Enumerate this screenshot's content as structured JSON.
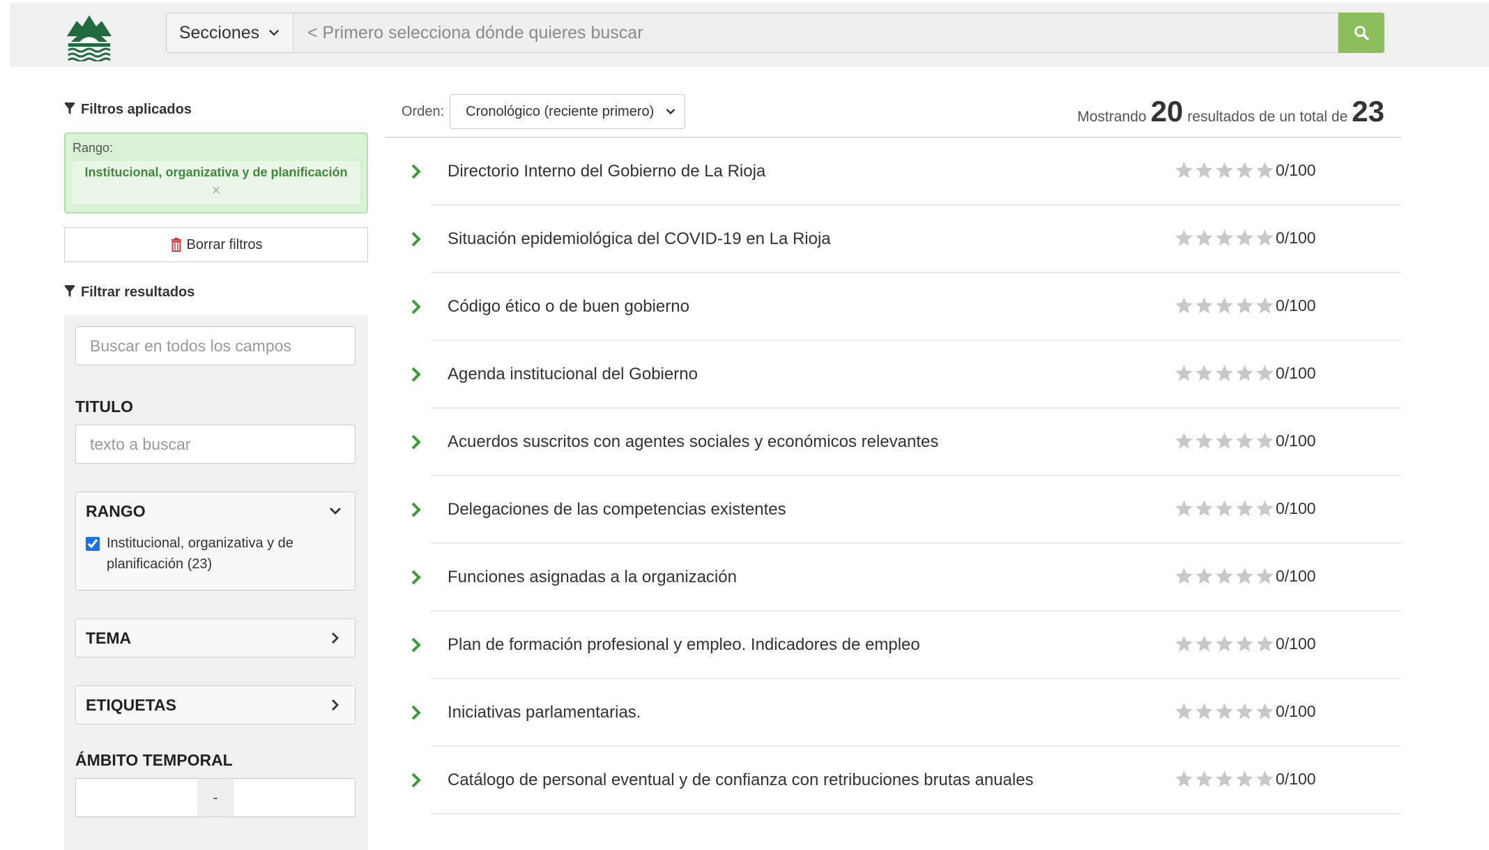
{
  "header": {
    "sections_label": "Secciones",
    "search_placeholder": "< Primero selecciona dónde quieres buscar",
    "accent_color": "#8cbe5c"
  },
  "sidebar": {
    "applied_heading": "Filtros aplicados",
    "applied": {
      "label": "Rango:",
      "value": "Institucional, organizativa y de planificación",
      "remove": "×"
    },
    "clear_label": "Borrar filtros",
    "filter_heading": "Filtrar resultados",
    "search_all_placeholder": "Buscar en todos los campos",
    "titulo_label": "TITULO",
    "titulo_placeholder": "texto a buscar",
    "rango": {
      "label": "RANGO",
      "option": "Institucional, organizativa y de planificación (23)",
      "checked": true
    },
    "tema_label": "TEMA",
    "etiquetas_label": "ETIQUETAS",
    "ambito_label": "ÁMBITO TEMPORAL",
    "range_separator": "-"
  },
  "results": {
    "order_label": "Orden:",
    "order_value": "Cronológico (reciente primero)",
    "count_prefix": "Mostrando",
    "count_shown": "20",
    "count_middle": "resultados de un total de",
    "count_total": "23",
    "items": [
      {
        "title": "Directorio Interno del Gobierno de La Rioja",
        "score": "0/100"
      },
      {
        "title": "Situación epidemiológica del COVID-19 en La Rioja",
        "score": "0/100"
      },
      {
        "title": "Código ético o de buen gobierno",
        "score": "0/100"
      },
      {
        "title": "Agenda institucional del Gobierno",
        "score": "0/100"
      },
      {
        "title": "Acuerdos suscritos con agentes sociales y económicos relevantes",
        "score": "0/100"
      },
      {
        "title": "Delegaciones de las competencias existentes",
        "score": "0/100"
      },
      {
        "title": "Funciones asignadas a la organización",
        "score": "0/100"
      },
      {
        "title": "Plan de formación profesional y empleo. Indicadores de empleo",
        "score": "0/100"
      },
      {
        "title": "Iniciativas parlamentarias.",
        "score": "0/100"
      },
      {
        "title": "Catálogo de personal eventual y de confianza con retribuciones brutas anuales",
        "score": "0/100"
      }
    ]
  }
}
